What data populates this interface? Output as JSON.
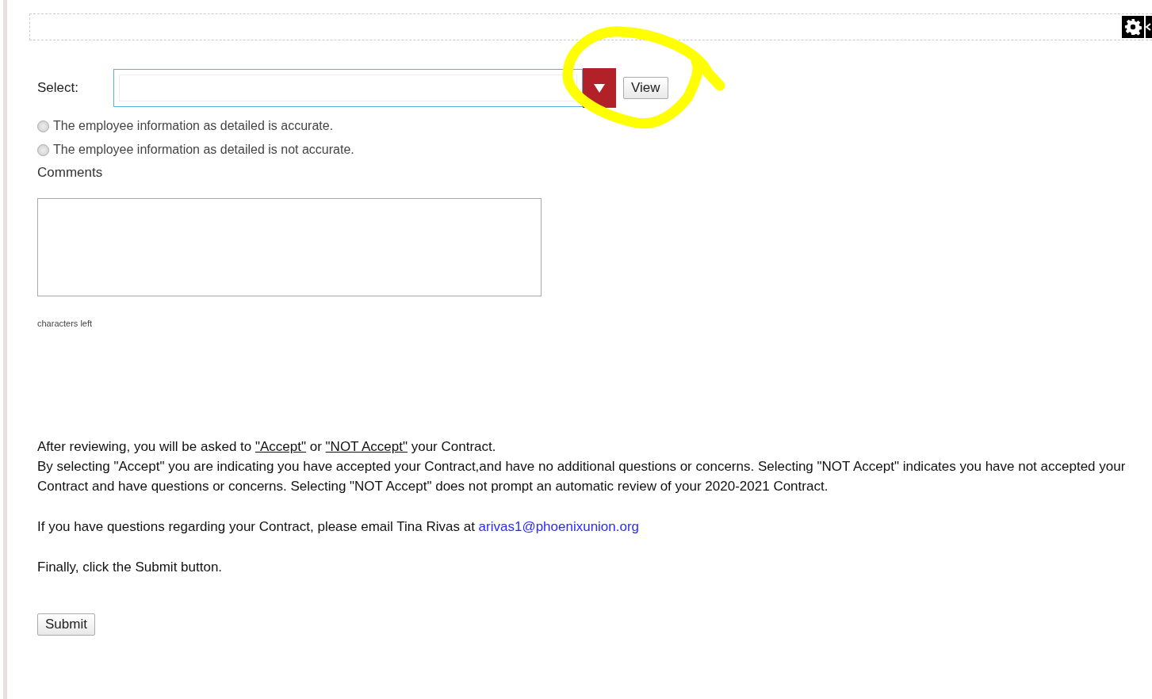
{
  "select": {
    "label": "Select:",
    "view_button": "View"
  },
  "options": [
    {
      "label": "The employee information as detailed is accurate.",
      "selected": false
    },
    {
      "label": "The employee information as detailed is not accurate.",
      "selected": false
    }
  ],
  "comments": {
    "label": "Comments",
    "counter": "characters left"
  },
  "intro": {
    "before": "After reviewing, you will be asked to ",
    "link_accept": "\"Accept\"",
    "middle": " or ",
    "link_not_accept": "\"NOT Accept\"",
    "after": " your Contract."
  },
  "explanation": "By selecting \"Accept\" you are indicating you have accepted your Contract,and have no additional questions or concerns. Selecting \"NOT Accept\" indicates you have not accepted your Contract and have questions or concerns. Selecting \"NOT Accept\" does not prompt an automatic review of your 2020-2021 Contract.",
  "contact": {
    "text": "If you have questions regarding your Contract, please email Tina Rivas at ",
    "email": "arivas1@phoenixunion.org"
  },
  "final_note": "Finally, click the Submit button.",
  "submit_button": "Submit"
}
